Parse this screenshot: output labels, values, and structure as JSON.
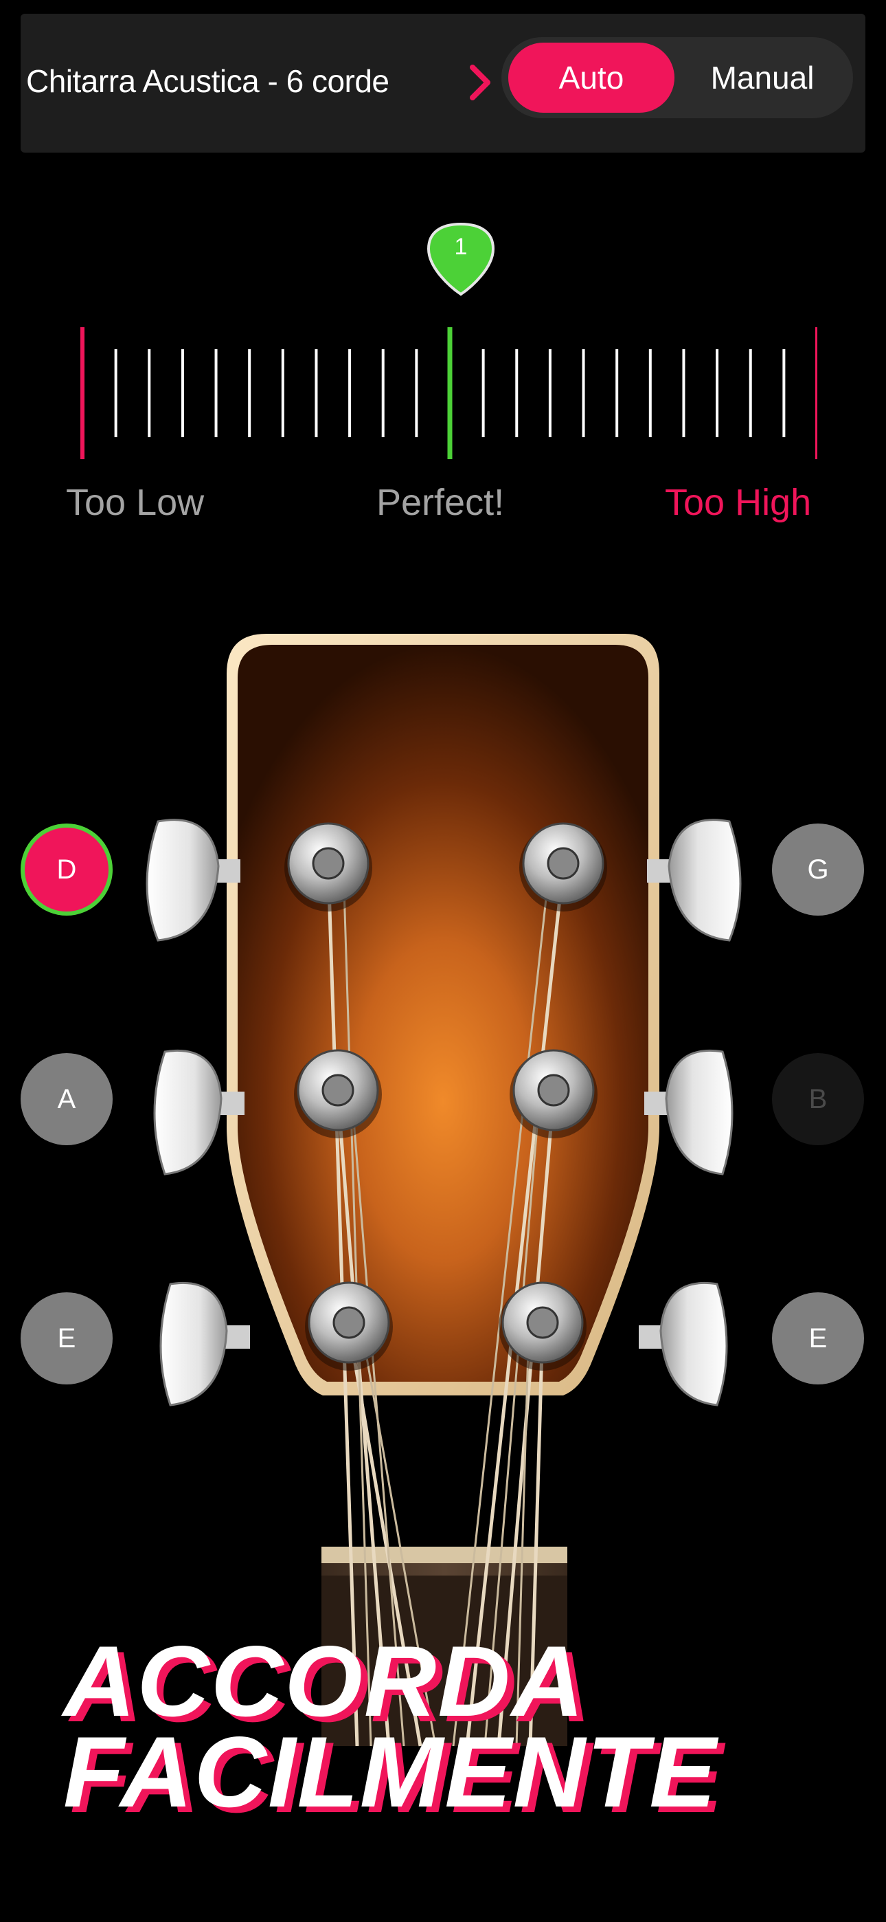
{
  "header": {
    "instrument": "Chitarra Acustica - 6 corde",
    "mode_auto": "Auto",
    "mode_manual": "Manual"
  },
  "tuner": {
    "string_indicator": "1",
    "too_low": "Too Low",
    "perfect": "Perfect!",
    "too_high": "Too High"
  },
  "strings": {
    "left": [
      "D",
      "A",
      "E"
    ],
    "right": [
      "G",
      "B",
      "E"
    ],
    "selected": "D"
  },
  "promo": {
    "line1": "ACCORDA",
    "line2": "FACILMENTE"
  },
  "colors": {
    "accent": "#f0155a",
    "in_tune": "#4cd137",
    "wood_center": "#e8862b",
    "wood_edge": "#2a0f02"
  }
}
